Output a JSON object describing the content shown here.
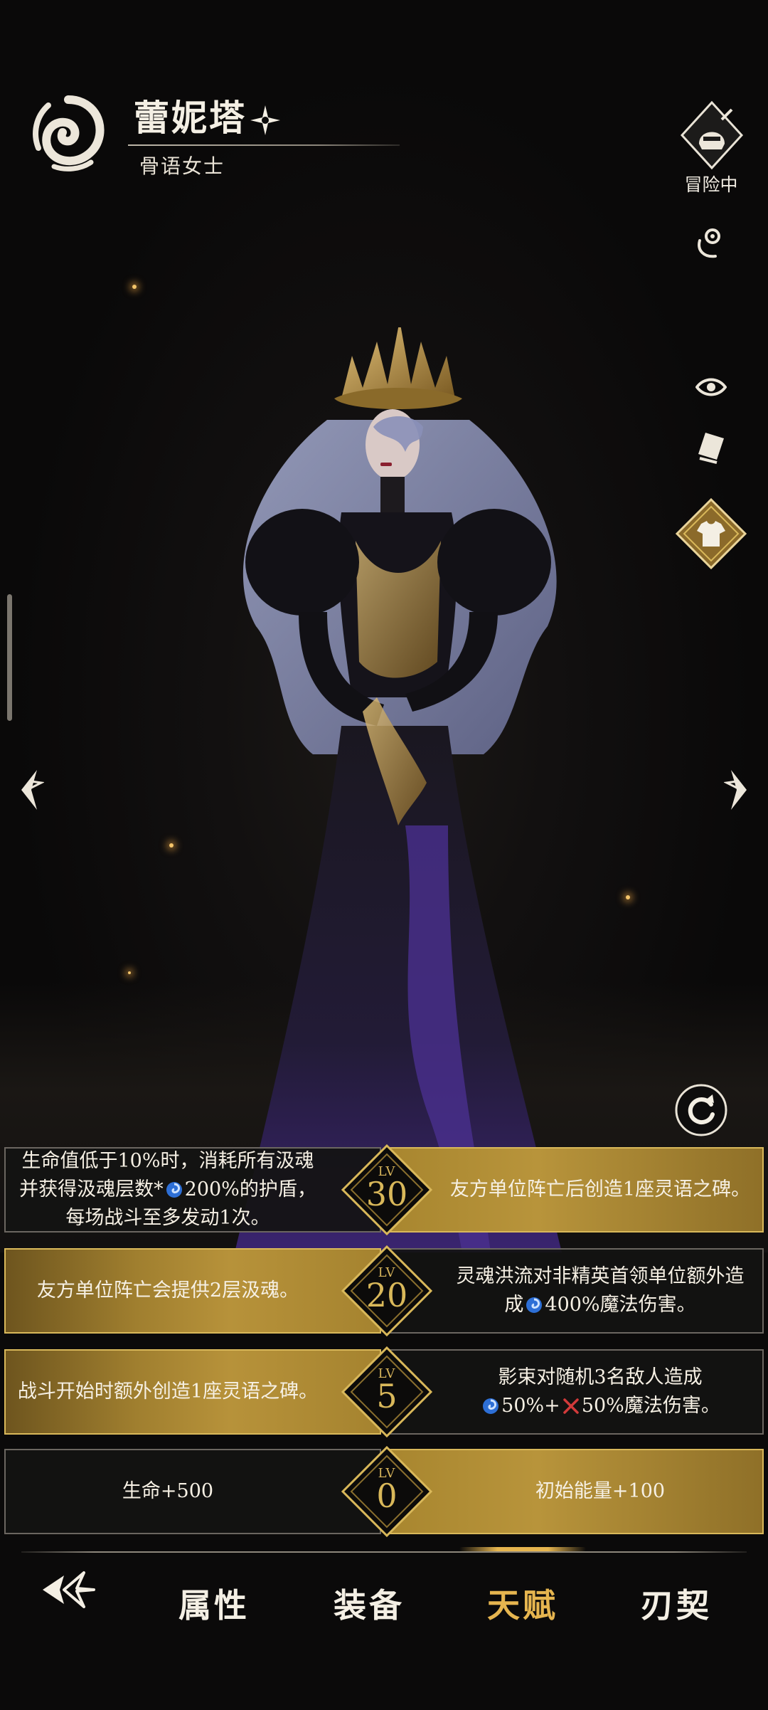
{
  "hero": {
    "name": "蕾妮塔",
    "title": "骨语女士"
  },
  "side": {
    "adventure_label": "冒险中"
  },
  "talents": [
    {
      "level": "30",
      "lv_label": "LV",
      "left_pre": "生命值低于10%时，消耗所有汲魂并获得汲魂层数*",
      "left_post": "200%的护盾，每场战斗至多发动1次。",
      "right_pre": "友方单位阵亡后创造1座灵语之碑。",
      "right_post": "",
      "active_side": "right"
    },
    {
      "level": "20",
      "lv_label": "LV",
      "left_pre": "友方单位阵亡会提供2层汲魂。",
      "left_post": "",
      "right_pre": "灵魂洪流对非精英首领单位额外造成",
      "right_post": "400%魔法伤害。",
      "active_side": "left"
    },
    {
      "level": "5",
      "lv_label": "LV",
      "left_pre": "战斗开始时额外创造1座灵语之碑。",
      "left_post": "",
      "right_pre": "影束对随机3名敌人造成",
      "right_mid": "50%+",
      "right_post": "50%魔法伤害。",
      "active_side": "left"
    },
    {
      "level": "0",
      "lv_label": "LV",
      "left_pre": "生命+500",
      "left_post": "",
      "right_pre": "初始能量+100",
      "right_post": "",
      "active_side": "right"
    }
  ],
  "nav": {
    "items": [
      "属性",
      "装备",
      "天赋",
      "刃契"
    ],
    "active": "天赋"
  },
  "colors": {
    "accent_gold": "#e6b54f",
    "panel_gold": "#b8943b",
    "background": "#0b0a0a"
  }
}
